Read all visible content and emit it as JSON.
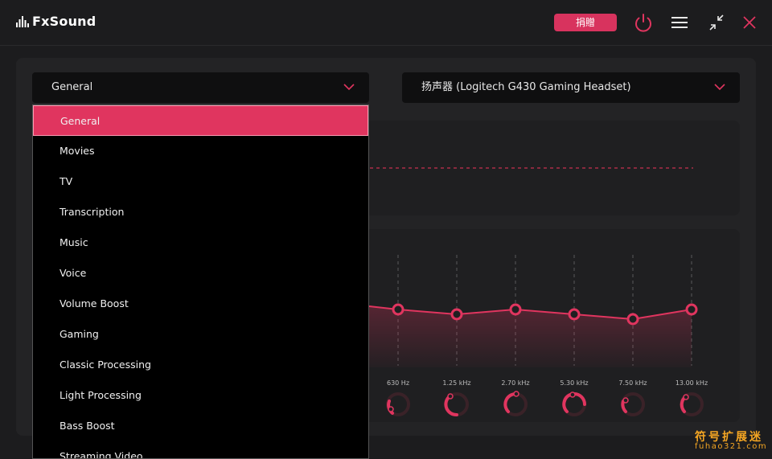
{
  "app": {
    "name": "FxSound"
  },
  "header": {
    "donate_label": "捐贈",
    "icons": [
      "power-icon",
      "menu-icon",
      "minimize-icon",
      "close-icon"
    ]
  },
  "preset": {
    "selected": "General",
    "options": [
      "General",
      "Movies",
      "TV",
      "Transcription",
      "Music",
      "Voice",
      "Volume Boost",
      "Gaming",
      "Classic Processing",
      "Light Processing",
      "Bass Boost",
      "Streaming Video"
    ]
  },
  "output_device": {
    "selected": "扬声器 (Logitech G430 Gaming Headset)"
  },
  "equalizer": {
    "bands": [
      {
        "label": "630 Hz"
      },
      {
        "label": "1.25 kHz"
      },
      {
        "label": "2.70 kHz"
      },
      {
        "label": "5.30 kHz"
      },
      {
        "label": "7.50 kHz"
      },
      {
        "label": "13.00 kHz"
      }
    ]
  },
  "colors": {
    "accent": "#e0355f",
    "background": "#1c1c1e",
    "panel": "#232325"
  },
  "watermark": {
    "cn": "符号扩展迷",
    "en": "fuhao321.com"
  }
}
